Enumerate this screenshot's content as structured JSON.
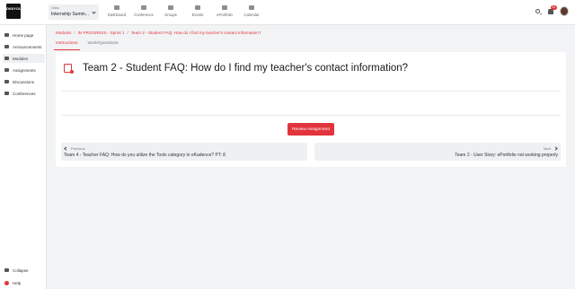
{
  "header": {
    "logo_text": "DIGIYOU",
    "class_select": {
      "caption": "Class",
      "value": "Internship Summ..."
    },
    "nav": [
      {
        "label": "Dashboard",
        "icon": "dashboard-icon"
      },
      {
        "label": "Conference",
        "icon": "video-icon"
      },
      {
        "label": "Groups",
        "icon": "groups-icon"
      },
      {
        "label": "Events",
        "icon": "location-pin-icon"
      },
      {
        "label": "ePortfolio",
        "icon": "portfolio-icon"
      },
      {
        "label": "Calendar",
        "icon": "calendar-icon"
      }
    ],
    "notification_count": "41"
  },
  "sidebar": {
    "items": [
      {
        "label": "Home page",
        "icon": "home-icon"
      },
      {
        "label": "Announcements",
        "icon": "megaphone-icon"
      },
      {
        "label": "Modules",
        "icon": "modules-icon",
        "active": true
      },
      {
        "label": "Assignments",
        "icon": "assignments-icon"
      },
      {
        "label": "Discussions",
        "icon": "discussions-icon"
      },
      {
        "label": "Conferences",
        "icon": "conferences-icon"
      }
    ],
    "collapse_label": "Collapse",
    "help_label": "Help"
  },
  "breadcrumb": [
    "Modules",
    "IN PROGRESS - Sprint 1",
    "Team 2 - Student FAQ: How do I find my teacher's contact information?"
  ],
  "tabs": [
    {
      "label": "Instructions",
      "active": true
    },
    {
      "label": "Work/Questions",
      "active": false
    }
  ],
  "main": {
    "title": "Team 2 - Student FAQ: How do I find my teacher's contact information?",
    "review_button": "Review Assignment",
    "prev": {
      "dir": "Previous",
      "title": "Team 4 - Teacher FAQ: How do you utilize the Tools category in eKadence?  PT: 8"
    },
    "next": {
      "dir": "Next",
      "title": "Team 2 - User Story: ePortfolio not working properly"
    }
  },
  "colors": {
    "accent": "#e2343c",
    "background": "#f2f3f5"
  }
}
